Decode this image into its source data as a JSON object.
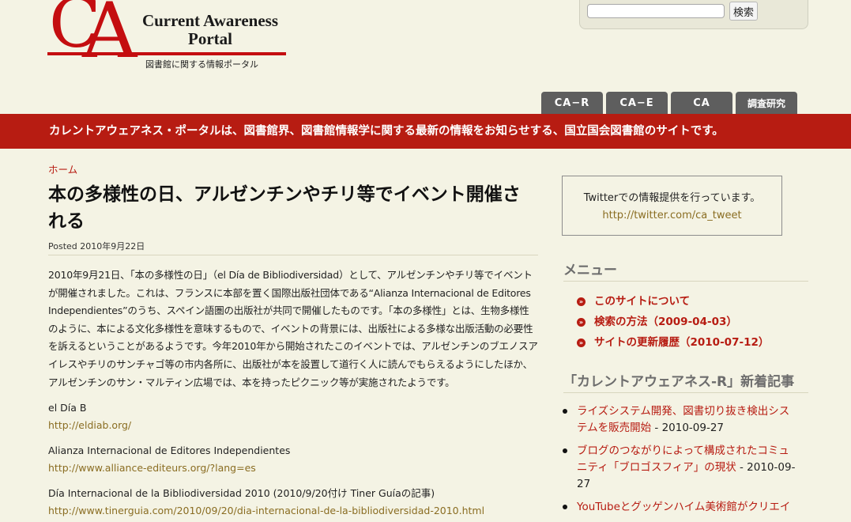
{
  "logo": {
    "letters": "CA",
    "title_line1": "Current Awareness",
    "title_line2": "Portal",
    "subtitle": "図書館に関する情報ポータル"
  },
  "search": {
    "placeholder": "",
    "value": "",
    "button_label": "検索"
  },
  "tabs": [
    "CA−R",
    "CA−E",
    "CA",
    "調査研究"
  ],
  "banner": "カレントアウェアネス・ポータルは、図書館界、図書館情報学に関する最新の情報をお知らせする、国立国会図書館のサイトです。",
  "breadcrumb": "ホーム",
  "article": {
    "title": "本の多様性の日、アルゼンチンやチリ等でイベント開催される",
    "posted": "Posted 2010年9月22日",
    "body": "2010年9月21日、「本の多様性の日」（el Día de Bibliodiversidad）として、アルゼンチンやチリ等でイベントが開催されました。これは、フランスに本部を置く国際出版社団体である“Alianza Internacional de Editores Independientes”のうち、スペイン語圏の出版社が共同で開催したものです。「本の多様性」とは、生物多様性のように、本による文化多様性を意味するもので、イベントの背景には、出版社による多様な出版活動の必要性を訴えるということがあるようです。今年2010年から開始されたこのイベントでは、アルゼンチンのブエノスアイレスやチリのサンチャゴ等の市内各所に、出版社が本を設置して道行く人に読んでもらえるようにしたほか、アルゼンチンのサン・マルティン広場では、本を持ったピクニック等が実施されたようです。",
    "refs": [
      {
        "label": "el Día B",
        "url": "http://eldiab.org/"
      },
      {
        "label": "Alianza Internacional de Editores Independientes",
        "url": "http://www.alliance-editeurs.org/?lang=es"
      },
      {
        "label": "Día Internacional de la Bibliodiversidad 2010 (2010/9/20付け Tiner Guíaの記事)",
        "url": "http://www.tinerguia.com/2010/09/20/dia-internacional-de-la-bibliodiversidad-2010.html"
      }
    ]
  },
  "sidebar": {
    "twitter_text": "Twitterでの情報提供を行っています。",
    "twitter_url": "http://twitter.com/ca_tweet",
    "menu_heading": "メニュー",
    "menu_items": [
      "このサイトについて",
      "検索の方法（2009-04-03）",
      "サイトの更新履歴（2010-07-12）"
    ],
    "news_heading": "「カレントアウェアネス-R」新着記事",
    "news_items": [
      {
        "title": "ライズシステム開発、図書切り抜き検出システムを販売開始",
        "date": " - 2010-09-27"
      },
      {
        "title": "ブログのつながりによって構成されたコミュニティ「ブロゴスフィア」の現状",
        "date": " - 2010-09-27"
      },
      {
        "title": "YouTubeとグッゲンハイム美術館がクリエイ",
        "date": ""
      }
    ]
  },
  "colors": {
    "brand_red": "#b71c12",
    "link": "#8a6d22",
    "background": "#f4f3e4",
    "tab": "#5e5e5e"
  }
}
